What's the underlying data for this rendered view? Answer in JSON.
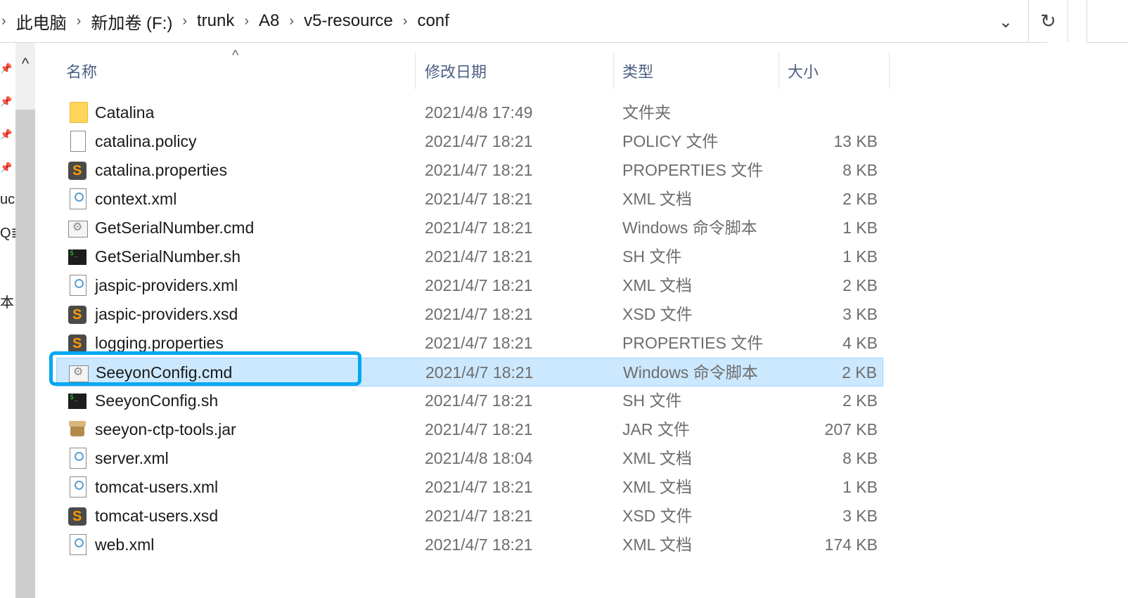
{
  "breadcrumb": [
    "此电脑",
    "新加卷 (F:)",
    "trunk",
    "A8",
    "v5-resource",
    "conf"
  ],
  "breadcrumb_separator": "›",
  "nav_fragments": [
    "uc",
    "Q≣",
    "本"
  ],
  "columns": {
    "name": "名称",
    "date": "修改日期",
    "type": "类型",
    "size": "大小"
  },
  "files": [
    {
      "name": "Catalina",
      "date": "2021/4/8 17:49",
      "type": "文件夹",
      "size": "",
      "icon": "folder-icon"
    },
    {
      "name": "catalina.policy",
      "date": "2021/4/7 18:21",
      "type": "POLICY 文件",
      "size": "13 KB",
      "icon": "blank-file-icon"
    },
    {
      "name": "catalina.properties",
      "date": "2021/4/7 18:21",
      "type": "PROPERTIES 文件",
      "size": "8 KB",
      "icon": "sublime-file-icon"
    },
    {
      "name": "context.xml",
      "date": "2021/4/7 18:21",
      "type": "XML 文档",
      "size": "2 KB",
      "icon": "xml-file-icon"
    },
    {
      "name": "GetSerialNumber.cmd",
      "date": "2021/4/7 18:21",
      "type": "Windows 命令脚本",
      "size": "1 KB",
      "icon": "cmd-file-icon"
    },
    {
      "name": "GetSerialNumber.sh",
      "date": "2021/4/7 18:21",
      "type": "SH 文件",
      "size": "1 KB",
      "icon": "sh-file-icon"
    },
    {
      "name": "jaspic-providers.xml",
      "date": "2021/4/7 18:21",
      "type": "XML 文档",
      "size": "2 KB",
      "icon": "xml-file-icon"
    },
    {
      "name": "jaspic-providers.xsd",
      "date": "2021/4/7 18:21",
      "type": "XSD 文件",
      "size": "3 KB",
      "icon": "sublime-file-icon"
    },
    {
      "name": "logging.properties",
      "date": "2021/4/7 18:21",
      "type": "PROPERTIES 文件",
      "size": "4 KB",
      "icon": "sublime-file-icon"
    },
    {
      "name": "SeeyonConfig.cmd",
      "date": "2021/4/7 18:21",
      "type": "Windows 命令脚本",
      "size": "2 KB",
      "icon": "cmd-file-icon",
      "selected": true
    },
    {
      "name": "SeeyonConfig.sh",
      "date": "2021/4/7 18:21",
      "type": "SH 文件",
      "size": "2 KB",
      "icon": "sh-file-icon"
    },
    {
      "name": "seeyon-ctp-tools.jar",
      "date": "2021/4/7 18:21",
      "type": "JAR 文件",
      "size": "207 KB",
      "icon": "jar-file-icon"
    },
    {
      "name": "server.xml",
      "date": "2021/4/8 18:04",
      "type": "XML 文档",
      "size": "8 KB",
      "icon": "xml-file-icon"
    },
    {
      "name": "tomcat-users.xml",
      "date": "2021/4/7 18:21",
      "type": "XML 文档",
      "size": "1 KB",
      "icon": "xml-file-icon"
    },
    {
      "name": "tomcat-users.xsd",
      "date": "2021/4/7 18:21",
      "type": "XSD 文件",
      "size": "3 KB",
      "icon": "sublime-file-icon"
    },
    {
      "name": "web.xml",
      "date": "2021/4/7 18:21",
      "type": "XML 文档",
      "size": "174 KB",
      "icon": "xml-file-icon"
    }
  ],
  "colors": {
    "selection_bg": "#cce8ff",
    "selection_border": "#99d1ff",
    "highlight_annotation": "#00a8f0",
    "header_text": "#4d6082"
  }
}
